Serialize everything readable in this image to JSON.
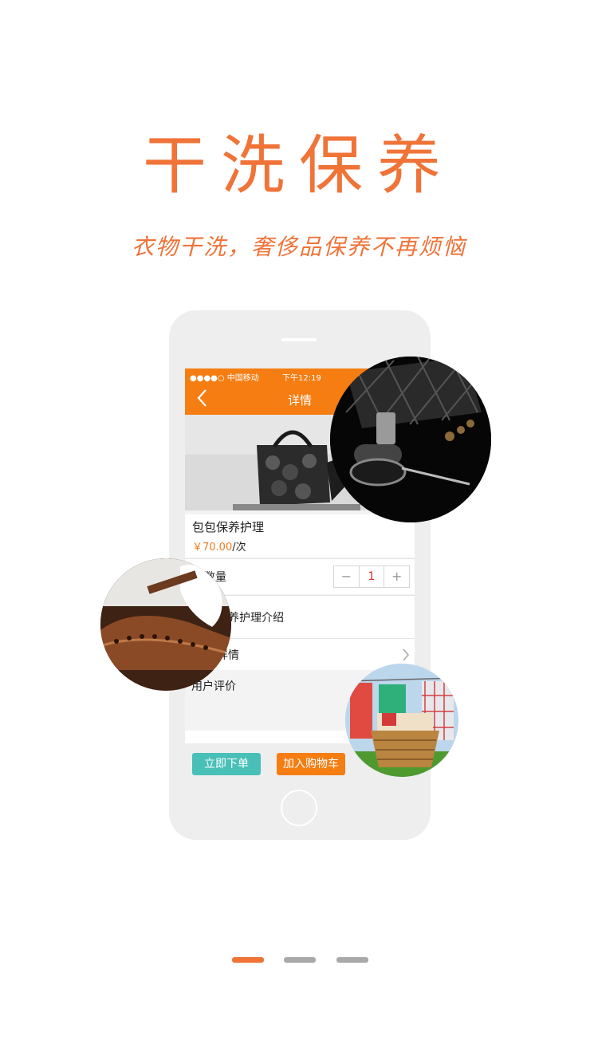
{
  "headline": "干洗保养",
  "subhead": "衣物干洗，奢侈品保养不再烦恼",
  "app": {
    "status": {
      "carrier": "●●●●○ 中国移动",
      "time": "下午12:19"
    },
    "navbar": {
      "title": "详情"
    },
    "product": {
      "name": "包包保养护理",
      "price": "￥70.00",
      "unit": "/次"
    },
    "quantity": {
      "label": "数量",
      "minus": "−",
      "value": "1",
      "plus": "+"
    },
    "intro": {
      "label": "养护理介绍"
    },
    "detail": {
      "label": "详情"
    },
    "reviews": {
      "label": "用户评价"
    },
    "buttons": {
      "order": "立即下单",
      "cart": "加入购物车"
    }
  },
  "pagination": {
    "count": 3,
    "active_index": 0
  },
  "colors": {
    "accent": "#f07338",
    "nav": "#f57d12",
    "teal": "#48c0b8",
    "inactive_dot": "#a9a9a9"
  }
}
